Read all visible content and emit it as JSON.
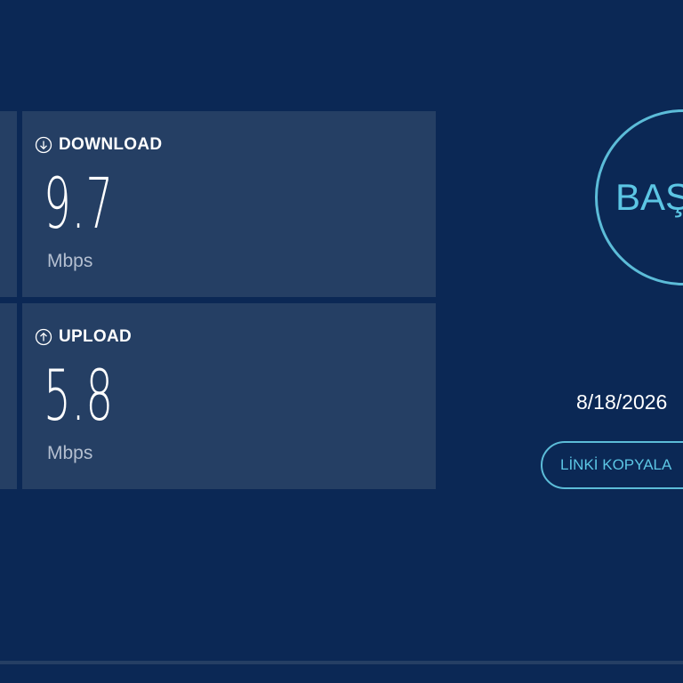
{
  "download": {
    "label": "DOWNLOAD",
    "value": "9.7",
    "unit": "Mbps",
    "icon": "arrow-down-circle-icon"
  },
  "upload": {
    "label": "UPLOAD",
    "value": "5.8",
    "unit": "Mbps",
    "icon": "arrow-up-circle-icon"
  },
  "start_button": {
    "label": "BAŞ"
  },
  "result": {
    "date": "8/18/2026"
  },
  "copy_link": {
    "label": "LİNKİ KOPYALA"
  },
  "colors": {
    "background": "#0b2855",
    "panel": "#253f64",
    "accent": "#5cbcd8",
    "text": "#ffffff",
    "unit_text": "#b4bfd0"
  }
}
